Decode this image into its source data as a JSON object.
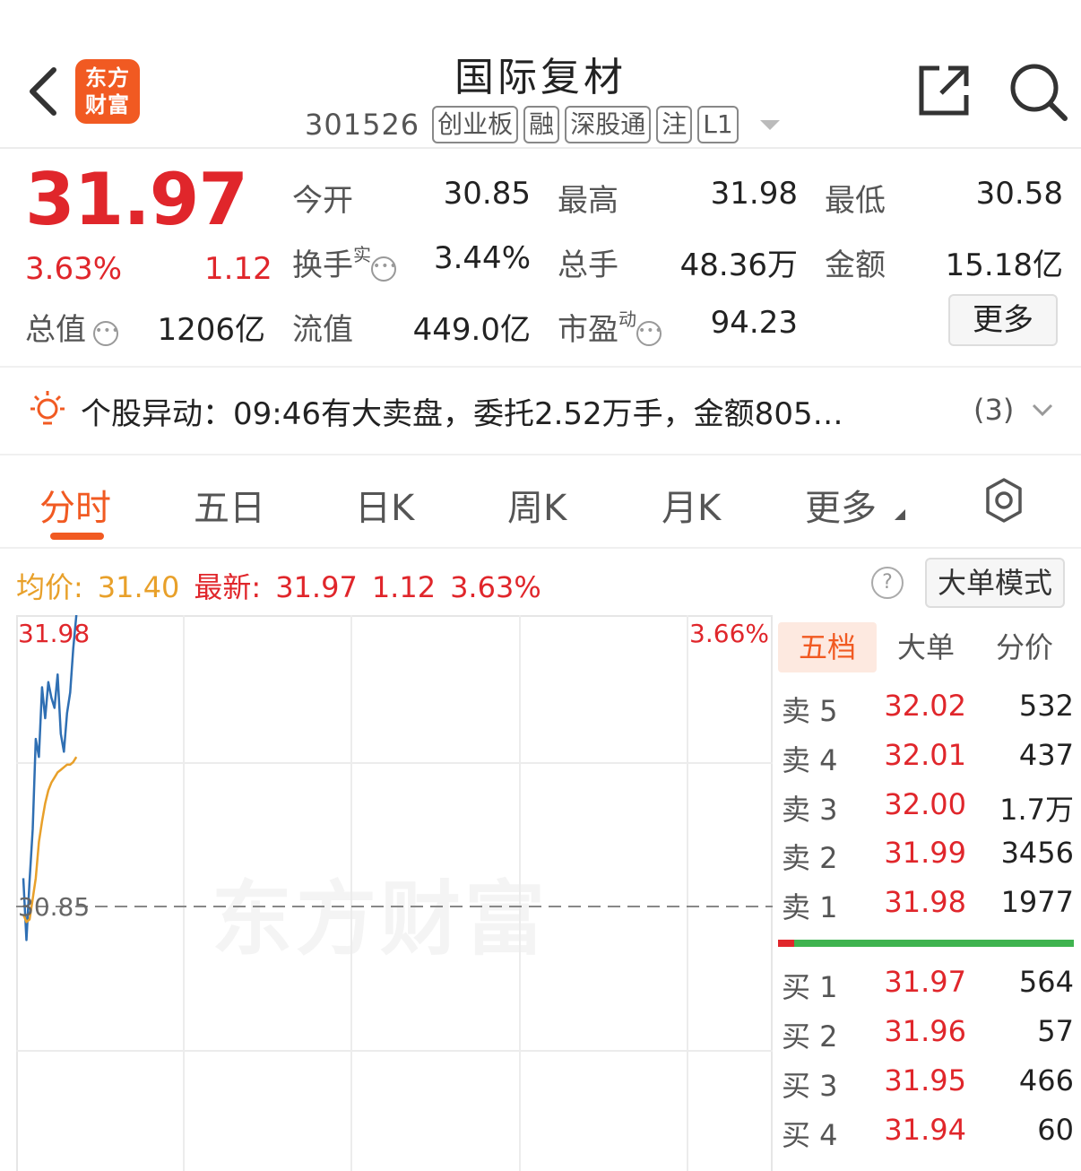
{
  "header": {
    "logo_text": "东方财富",
    "stock_name": "国际复材",
    "stock_code": "301526",
    "tags": [
      "创业板",
      "融",
      "深股通",
      "注",
      "L1"
    ]
  },
  "quote": {
    "price": "31.97",
    "change_pct": "3.63%",
    "change_amt": "1.12",
    "open_label": "今开",
    "open": "30.85",
    "high_label": "最高",
    "high": "31.98",
    "low_label": "最低",
    "low": "30.58",
    "turnover_label": "换手",
    "turnover_sup": "实",
    "turnover": "3.44%",
    "volume_label": "总手",
    "volume": "48.36万",
    "amount_label": "金额",
    "amount": "15.18亿",
    "mktcap_label": "总值",
    "mktcap": "1206亿",
    "float_label": "流值",
    "float": "449.0亿",
    "pe_label": "市盈",
    "pe_sup": "动",
    "pe": "94.23",
    "more_label": "更多"
  },
  "alert": {
    "text": "个股异动：09:46有大卖盘，委托2.52万手，金额805…",
    "count": "(3)"
  },
  "tabs": [
    "分时",
    "五日",
    "日K",
    "周K",
    "月K",
    "更多"
  ],
  "info_line": {
    "avg_label": "均价:",
    "avg_value": "31.40",
    "latest_label": "最新:",
    "latest_price": "31.97",
    "latest_chg": "1.12",
    "latest_pct": "3.63%",
    "help_icon": "?",
    "bigorder_label": "大单模式"
  },
  "chart_data": {
    "type": "line",
    "title": "",
    "y_top_label": "31.98",
    "y_mid_label": "30.85",
    "pct_top_label": "3.66%",
    "watermark": "东方财富",
    "ylim": [
      29.72,
      31.98
    ],
    "reference_price": 30.85,
    "x_minutes_total": 240,
    "series": [
      {
        "color": "#2f6fb3",
        "x": [
          0,
          1,
          2,
          3,
          4,
          5,
          6,
          7,
          8,
          9,
          10,
          11,
          12,
          13,
          14,
          15,
          16,
          17
        ],
        "values": [
          30.96,
          30.72,
          30.95,
          31.15,
          31.5,
          31.43,
          31.7,
          31.58,
          31.72,
          31.66,
          31.62,
          31.75,
          31.52,
          31.45,
          31.6,
          31.68,
          31.85,
          31.98
        ]
      },
      {
        "color": "#e8a02a",
        "x": [
          0,
          1,
          2,
          3,
          4,
          5,
          6,
          7,
          8,
          9,
          10,
          11,
          12,
          13,
          14,
          15,
          16,
          17
        ],
        "values": [
          30.82,
          30.79,
          30.8,
          30.88,
          30.96,
          31.1,
          31.18,
          31.25,
          31.3,
          31.33,
          31.35,
          31.37,
          31.38,
          31.39,
          31.4,
          31.4,
          31.41,
          31.43
        ]
      }
    ]
  },
  "orderbook": {
    "tabs": [
      "五档",
      "大单",
      "分价"
    ],
    "asks": [
      {
        "label": "卖 5",
        "price": "32.02",
        "vol": "532"
      },
      {
        "label": "卖 4",
        "price": "32.01",
        "vol": "437"
      },
      {
        "label": "卖 3",
        "price": "32.00",
        "vol": "1.7万"
      },
      {
        "label": "卖 2",
        "price": "31.99",
        "vol": "3456"
      },
      {
        "label": "卖 1",
        "price": "31.98",
        "vol": "1977"
      }
    ],
    "bids": [
      {
        "label": "买 1",
        "price": "31.97",
        "vol": "564"
      },
      {
        "label": "买 2",
        "price": "31.96",
        "vol": "57"
      },
      {
        "label": "买 3",
        "price": "31.95",
        "vol": "466"
      },
      {
        "label": "买 4",
        "price": "31.94",
        "vol": "60"
      }
    ],
    "buy_sell_ratio": 0.055
  },
  "colors": {
    "up": "#e0262b",
    "down": "#2f9e3a",
    "accent": "#f15a22",
    "avg": "#e8a02a",
    "price_line": "#2f6fb3"
  }
}
